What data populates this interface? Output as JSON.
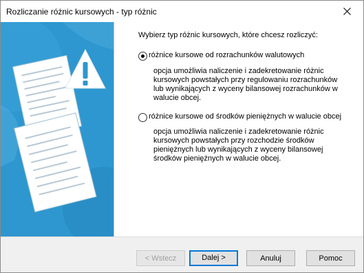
{
  "window": {
    "title": "Rozliczanie różnic kursowych - typ różnic"
  },
  "main": {
    "prompt": "Wybierz typ różnic kursowych, które chcesz rozliczyć:",
    "options": [
      {
        "label": "różnice kursowe od rozrachunków walutowych",
        "selected": true,
        "description": [
          "opcja umożliwia naliczenie i zadekretowanie różnic",
          "kursowych powstałych przy regulowaniu rozrachunków",
          "lub wynikających z wyceny bilansowej rozrachunków w",
          "walucie obcej."
        ]
      },
      {
        "label": "różnice kursowe od środków pieniężnych w walucie obcej",
        "selected": false,
        "description": [
          "opcja umożliwia naliczenie i zadekretowanie różnic",
          "kursowych powstałych przy rozchodzie środków",
          "pieniężnych lub wynikających z wyceny bilansowej",
          "środków pieniężnych w walucie obcej."
        ]
      }
    ]
  },
  "buttons": {
    "back": "< Wstecz",
    "next": "Dalej >",
    "cancel": "Anuluj",
    "help": "Pomoc"
  },
  "colors": {
    "side_panel": "#2e97cf",
    "default_button_border": "#0078d7"
  },
  "icons": {
    "close": "close-icon",
    "warning": "warning-icon",
    "documents": "documents-icon"
  }
}
